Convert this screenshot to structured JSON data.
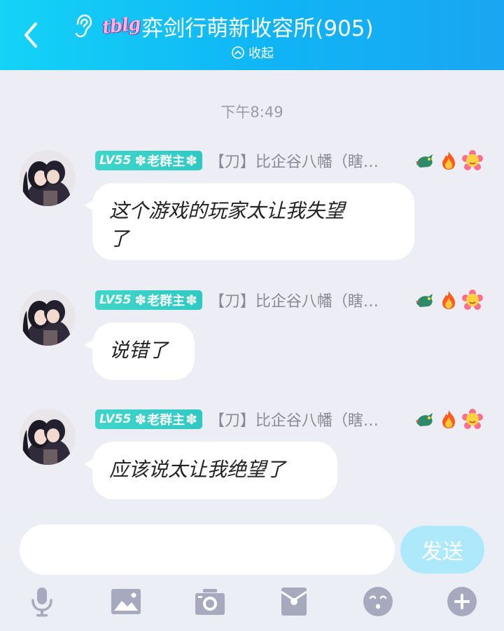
{
  "header": {
    "tag": "tblg",
    "title": "弈剑行萌新收容所(905)",
    "collapse_label": "收起"
  },
  "time_label": "下午8:49",
  "messages": [
    {
      "level": "LV55",
      "role": "老群主",
      "sender": "【刀】比企谷八幡（瞎…",
      "text_line1": "这个游戏的玩家太让我失望",
      "text_line2": "了"
    },
    {
      "level": "LV55",
      "role": "老群主",
      "sender": "【刀】比企谷八幡（瞎…",
      "text_line1": "说错了"
    },
    {
      "level": "LV55",
      "role": "老群主",
      "sender": "【刀】比企谷八幡（瞎…",
      "text_line1": "应该说太让我绝望了"
    }
  ],
  "input": {
    "placeholder": "",
    "send_label": "发送"
  },
  "colors": {
    "header_start": "#14d3f7",
    "header_end": "#1aa6f2",
    "badge": "#3fd5c9",
    "send_button": "#aee8fb",
    "toolbar_icon": "#a7a9bf"
  }
}
